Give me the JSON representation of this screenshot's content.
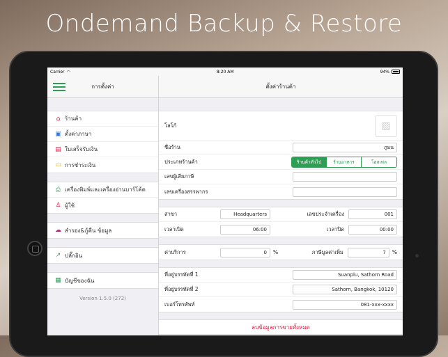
{
  "headline": "Ondemand Backup & Restore",
  "status": {
    "carrier": "Carrier",
    "time": "8:20 AM",
    "battery": "94%"
  },
  "nav": {
    "left_title": "การตั้งค่า",
    "right_title": "ตั้งค่าร้านค้า"
  },
  "sidebar": {
    "groups": [
      [
        {
          "label": "ร้านค้า",
          "icon": "home-icon",
          "color": "#e2163c"
        },
        {
          "label": "ตั้งค่าภาษา",
          "icon": "translate-icon",
          "color": "#2f7bd6"
        },
        {
          "label": "ใบเสร็จรับเงิน",
          "icon": "receipt-icon",
          "color": "#e2163c"
        },
        {
          "label": "การชำระเงิน",
          "icon": "credit-card-icon",
          "color": "#f0a500"
        }
      ],
      [
        {
          "label": "เครื่องพิมพ์และเครื่องอ่านบาร์โค้ด",
          "icon": "printer-icon",
          "color": "#2e9e55"
        },
        {
          "label": "ผู้ใช้",
          "icon": "user-icon",
          "color": "#e2163c"
        }
      ],
      [
        {
          "label": "สำรอง&กู้คืน ข้อมูล",
          "icon": "cloud-upload-icon",
          "color": "#b0307a"
        }
      ],
      [
        {
          "label": "ปลั๊กอิน",
          "icon": "plugin-icon",
          "color": "#2e9e55"
        }
      ],
      [
        {
          "label": "บัญชีของฉัน",
          "icon": "account-card-icon",
          "color": "#2e9e55"
        }
      ]
    ],
    "version": "Version 1.5.0 (272)"
  },
  "form": {
    "logo_label": "โลโก้",
    "shop_name_label": "ชื่อร้าน",
    "shop_name_value": "ภูมน",
    "shop_type_label": "ประเภทร้านค้า",
    "shop_type_options": [
      "ร้านค้าทั่วไป",
      "ร้านอาหาร",
      "โฮสเทล"
    ],
    "shop_type_selected": 0,
    "tax_id_label": "เลขผู้เสียภาษี",
    "revenue_machine_label": "เลขเครื่องสรรพากร",
    "branch_label": "สาขา",
    "branch_value": "Headquarters",
    "pos_no_label": "เลขประจำเครื่อง",
    "pos_no_value": "001",
    "open_label": "เวลาเปิด",
    "open_value": "06:00",
    "close_label": "เวลาปิด",
    "close_value": "00:00",
    "service_label": "ค่าบริการ",
    "service_value": "0",
    "vat_label": "ภาษีมูลค่าเพิ่ม",
    "vat_value": "7",
    "percent": "%",
    "address1_label": "ที่อยู่บรรทัดที่ 1",
    "address1_value": "Suanplu, Sathorn Road",
    "address2_label": "ที่อยู่บรรทัดที่ 2",
    "address2_value": "Sathorn, Bangkok, 10120",
    "phone_label": "เบอร์โทรศัพท์",
    "phone_value": "081-xxx-xxxx",
    "delete_label": "ลบข้อมูลการขายทั้งหมด"
  }
}
